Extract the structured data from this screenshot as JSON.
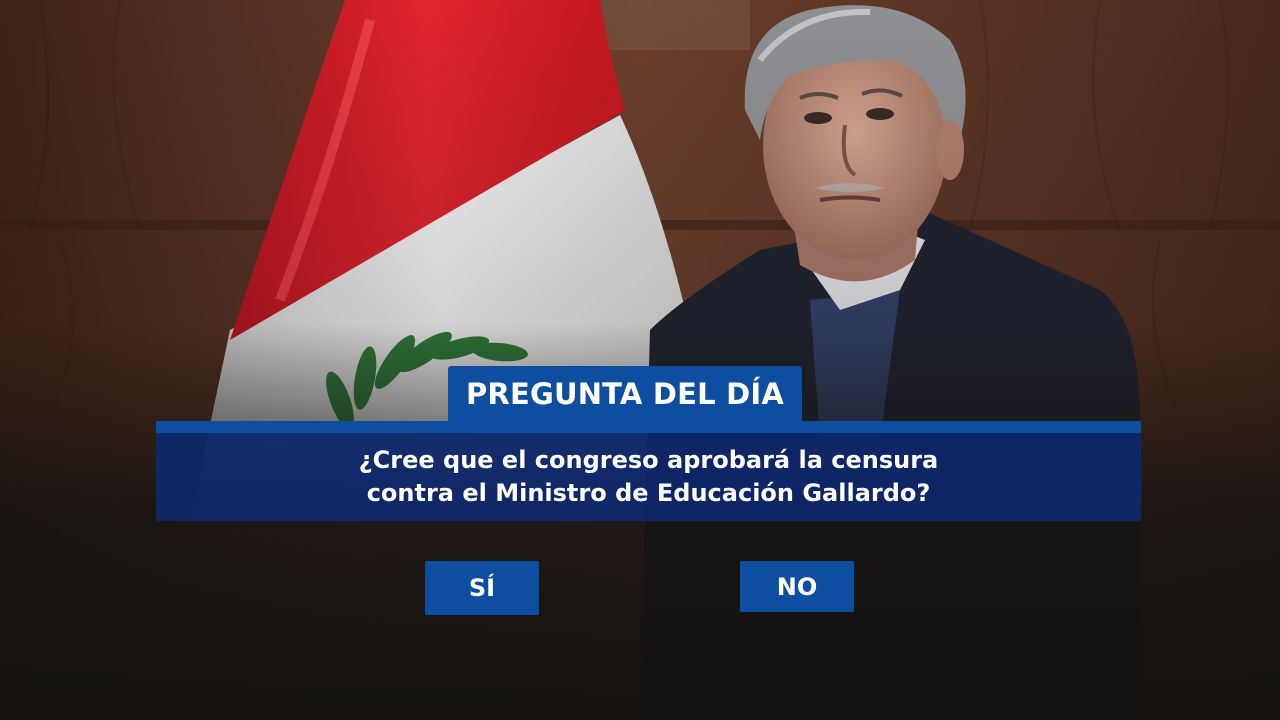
{
  "header": {
    "title": "PREGUNTA DEL DÍA"
  },
  "question": {
    "line1": "¿Cree que el congreso aprobará la censura",
    "line2": "contra el Ministro de Educación Gallardo?"
  },
  "answers": {
    "yes_label": "SÍ",
    "no_label": "NO"
  },
  "colors": {
    "accent_blue": "#0d4ea0",
    "question_panel": "#0e286c",
    "flag_red": "#d01c27",
    "flag_white": "#f2f2f2",
    "wood_background": "#5a3524"
  },
  "image": {
    "subjects": [
      "peruvian-flag",
      "elderly-man-portrait"
    ]
  }
}
